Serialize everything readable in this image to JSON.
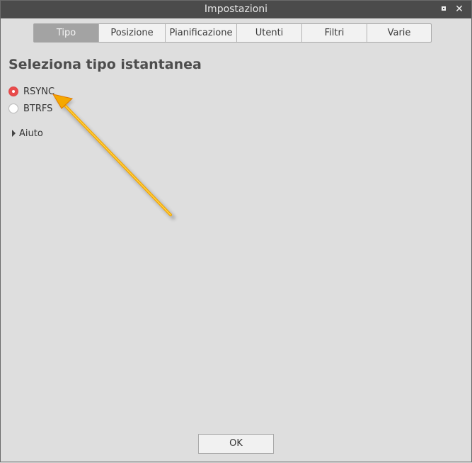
{
  "window": {
    "title": "Impostazioni"
  },
  "tabs": [
    {
      "label": "Tipo",
      "active": true
    },
    {
      "label": "Posizione",
      "active": false
    },
    {
      "label": "Pianificazione",
      "active": false
    },
    {
      "label": "Utenti",
      "active": false
    },
    {
      "label": "Filtri",
      "active": false
    },
    {
      "label": "Varie",
      "active": false
    }
  ],
  "content": {
    "title": "Seleziona tipo istantanea",
    "options": [
      {
        "label": "RSYNC",
        "selected": true
      },
      {
        "label": "BTRFS",
        "selected": false
      }
    ],
    "help_label": "Aiuto"
  },
  "footer": {
    "ok_label": "OK"
  },
  "colors": {
    "titlebar": "#4b4b4b",
    "active_tab": "#a3a3a3",
    "radio_selected": "#e84b4b",
    "annotation_arrow": "#f5a800"
  }
}
